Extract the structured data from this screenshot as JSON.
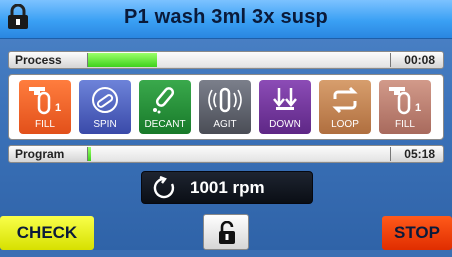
{
  "title": {
    "text": "P1 wash 3ml 3x susp",
    "lock_icon": "lock-icon"
  },
  "process": {
    "label": "Process",
    "progress_fraction": 0.23,
    "time": "00:08"
  },
  "steps": [
    {
      "label": "FILL",
      "icon": "faucet-tube-icon",
      "active": true
    },
    {
      "label": "SPIN",
      "icon": "spin-icon",
      "active": false
    },
    {
      "label": "DECANT",
      "icon": "decant-icon",
      "active": false
    },
    {
      "label": "AGIT",
      "icon": "agitate-icon",
      "active": false
    },
    {
      "label": "DOWN",
      "icon": "down-arrows-icon",
      "active": false
    },
    {
      "label": "LOOP",
      "icon": "loop-icon",
      "active": false
    },
    {
      "label": "FILL",
      "icon": "faucet-tube-icon",
      "active": false
    }
  ],
  "program": {
    "label": "Program",
    "progress_fraction": 0.01,
    "time": "05:18"
  },
  "rpm": {
    "value": "1001 rpm",
    "icon": "rotate-icon"
  },
  "buttons": {
    "check": "CHECK",
    "stop": "STOP",
    "unlock_icon": "unlock-icon"
  },
  "colors": {
    "title_bar": "#3aa0f4",
    "background": "#3d74bb",
    "progress_fill": "#3ed21c",
    "check": "#f0f500",
    "stop": "#f33c00"
  }
}
